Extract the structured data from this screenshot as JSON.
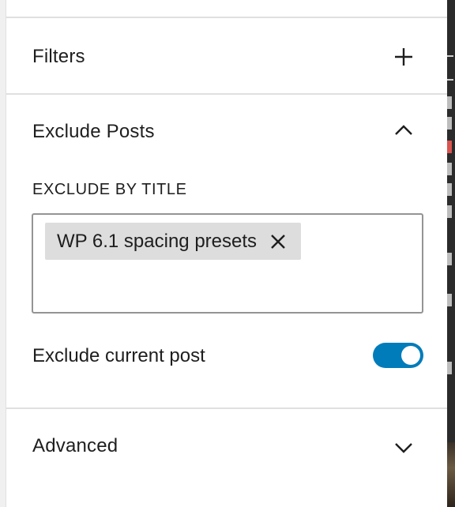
{
  "sections": {
    "filters": {
      "title": "Filters",
      "icon": "plus-icon",
      "expanded": false
    },
    "exclude_posts": {
      "title": "Exclude Posts",
      "icon": "chevron-up-icon",
      "expanded": true,
      "exclude_by_title": {
        "label": "EXCLUDE BY TITLE",
        "tokens": [
          "WP 6.1 spacing presets"
        ],
        "remove_icon": "close-icon"
      },
      "exclude_current_post": {
        "label": "Exclude current post",
        "enabled": true
      }
    },
    "advanced": {
      "title": "Advanced",
      "icon": "chevron-down-icon",
      "expanded": false
    }
  },
  "colors": {
    "accent": "#007cba",
    "token_bg": "#dddddd",
    "divider": "#e0e0e0",
    "field_border": "#949494",
    "text": "#1e1e1e"
  }
}
